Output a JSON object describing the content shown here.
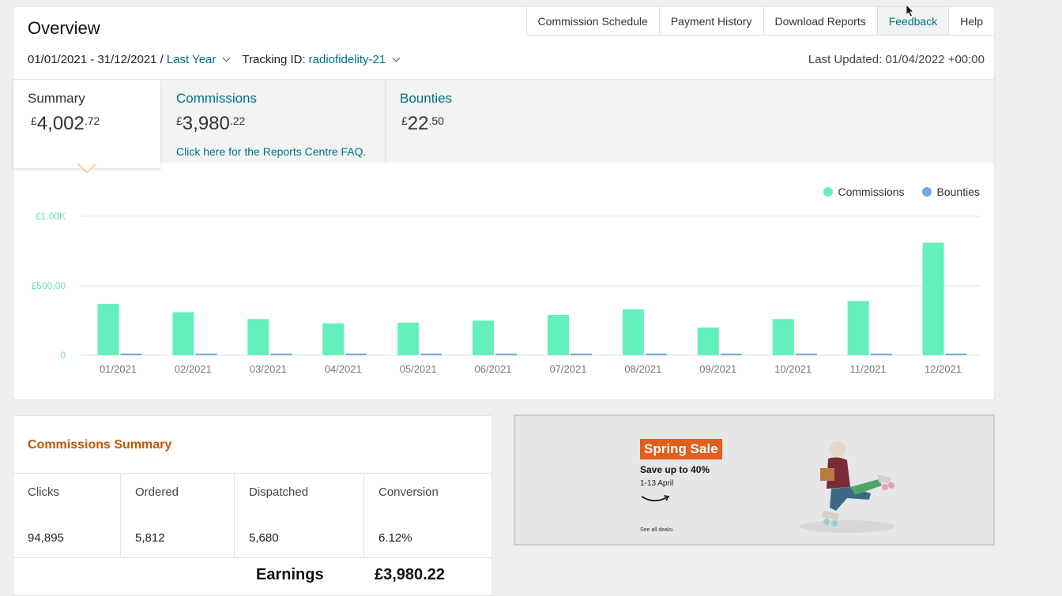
{
  "header": {
    "title": "Overview",
    "tabs": [
      "Commission Schedule",
      "Payment History",
      "Download Reports",
      "Feedback",
      "Help"
    ],
    "date_range": "01/01/2021 - 31/12/2021 /",
    "period": "Last Year",
    "tracking_label": "Tracking ID:",
    "tracking_id": "radiofidelity-21",
    "last_updated": "Last Updated: 01/04/2022 +00:00"
  },
  "stats": {
    "summary": {
      "label": "Summary",
      "currency": "£",
      "whole": "4,002",
      "fraction": ".72"
    },
    "commissions": {
      "label": "Commissions",
      "currency": "£",
      "whole": "3,980",
      "fraction": ".22",
      "faq": "Click here for the Reports Centre FAQ."
    },
    "bounties": {
      "label": "Bounties",
      "currency": "£",
      "whole": "22",
      "fraction": ".50"
    }
  },
  "colors": {
    "commissions": "#63f0bd",
    "bounties": "#6fa8e6",
    "link": "#007185",
    "accent": "#c45500"
  },
  "chart_data": {
    "type": "bar",
    "categories": [
      "01/2021",
      "02/2021",
      "03/2021",
      "04/2021",
      "05/2021",
      "06/2021",
      "07/2021",
      "08/2021",
      "09/2021",
      "10/2021",
      "11/2021",
      "12/2021"
    ],
    "series": [
      {
        "name": "Commissions",
        "values": [
          370,
          310,
          260,
          230,
          235,
          250,
          290,
          330,
          200,
          260,
          390,
          810
        ]
      },
      {
        "name": "Bounties",
        "values": [
          12,
          12,
          12,
          12,
          12,
          12,
          12,
          12,
          12,
          12,
          12,
          12
        ]
      }
    ],
    "yticks": [
      {
        "value": 0,
        "label": "0"
      },
      {
        "value": 500,
        "label": "£500.00"
      },
      {
        "value": 1000,
        "label": "£1.00K"
      }
    ],
    "ylim": [
      0,
      1000
    ],
    "legend": "top-right",
    "grid": true
  },
  "commissions_summary": {
    "title": "Commissions Summary",
    "columns": [
      {
        "header": "Clicks",
        "value": "94,895"
      },
      {
        "header": "Ordered",
        "value": "5,812"
      },
      {
        "header": "Dispatched",
        "value": "5,680"
      },
      {
        "header": "Conversion",
        "value": "6.12%"
      }
    ],
    "earnings_label": "Earnings",
    "earnings_value": "£3,980.22"
  },
  "ad": {
    "badge": "Spring Sale",
    "line1": "Save up to 40%",
    "line2": "1-13 April",
    "link": "See all deals›"
  }
}
